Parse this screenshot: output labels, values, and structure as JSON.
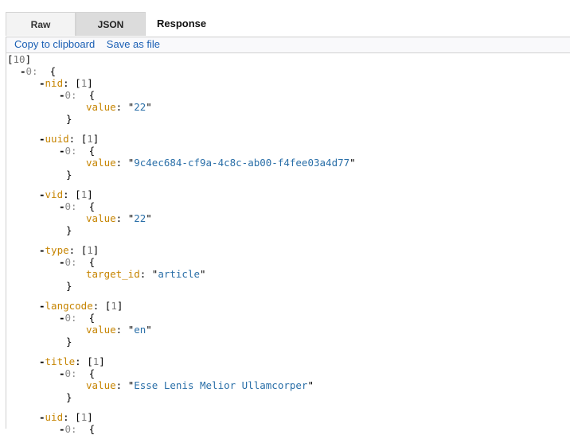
{
  "tabs": {
    "raw": "Raw",
    "json": "JSON",
    "title": "Response"
  },
  "toolbar": {
    "copy": "Copy to clipboard",
    "save": "Save as file"
  },
  "root": {
    "open": "[",
    "count": "10",
    "close": "]"
  },
  "first_item": {
    "toggle": "-",
    "index": "0:",
    "brace": "{"
  },
  "fields": [
    {
      "key": "nid",
      "count": "1",
      "sub_index": "0:",
      "inner_key": "value",
      "value": "22"
    },
    {
      "key": "uuid",
      "count": "1",
      "sub_index": "0:",
      "inner_key": "value",
      "value": "9c4ec684-cf9a-4c8c-ab00-f4fee03a4d77"
    },
    {
      "key": "vid",
      "count": "1",
      "sub_index": "0:",
      "inner_key": "value",
      "value": "22"
    },
    {
      "key": "type",
      "count": "1",
      "sub_index": "0:",
      "inner_key": "target_id",
      "value": "article"
    },
    {
      "key": "langcode",
      "count": "1",
      "sub_index": "0:",
      "inner_key": "value",
      "value": "en"
    },
    {
      "key": "title",
      "count": "1",
      "sub_index": "0:",
      "inner_key": "value",
      "value": "Esse Lenis Melior Ullamcorper"
    },
    {
      "key": "uid",
      "count": "1",
      "sub_index": "0:",
      "inner_key": "",
      "value": ""
    }
  ]
}
